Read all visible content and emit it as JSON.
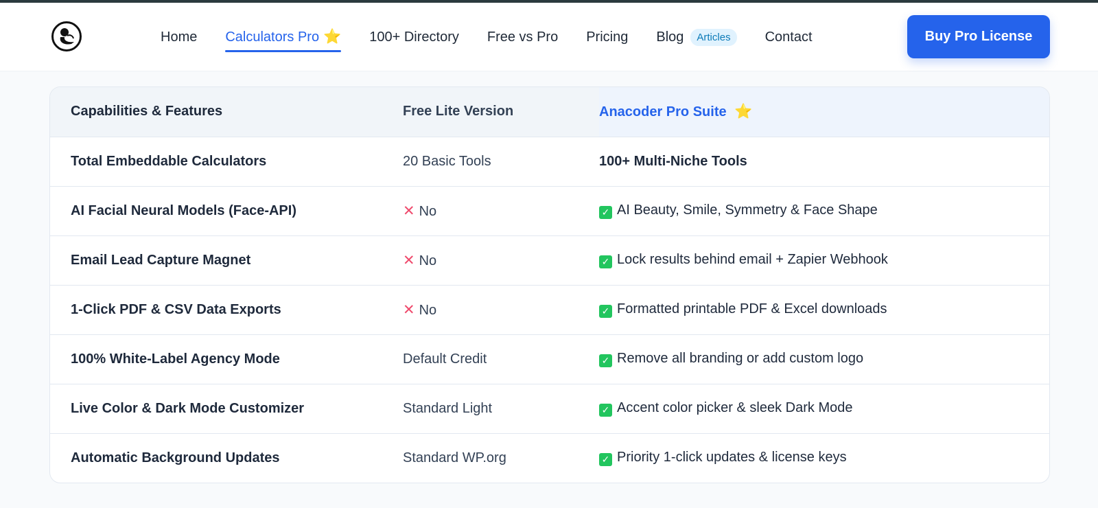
{
  "nav": {
    "items": [
      {
        "label": "Home"
      },
      {
        "label": "Calculators Pro",
        "active": true,
        "star": "⭐"
      },
      {
        "label": "100+ Directory"
      },
      {
        "label": "Free vs Pro"
      },
      {
        "label": "Pricing"
      },
      {
        "label": "Blog",
        "badge": "Articles"
      },
      {
        "label": "Contact"
      }
    ],
    "cta": "Buy Pro License"
  },
  "table": {
    "headers": {
      "feature": "Capabilities & Features",
      "free": "Free Lite Version",
      "pro": "Anacoder Pro Suite",
      "pro_star": "⭐"
    },
    "rows": [
      {
        "feature": "Total Embeddable Calculators",
        "free": "20 Basic Tools",
        "free_icon": "",
        "pro": "100+ Multi-Niche Tools",
        "pro_icon": ""
      },
      {
        "feature": "AI Facial Neural Models (Face-API)",
        "free": "No",
        "free_icon": "✕",
        "pro": "AI Beauty, Smile, Symmetry & Face Shape",
        "pro_icon": "✓"
      },
      {
        "feature": "Email Lead Capture Magnet",
        "free": "No",
        "free_icon": "✕",
        "pro": "Lock results behind email + Zapier Webhook",
        "pro_icon": "✓"
      },
      {
        "feature": "1-Click PDF & CSV Data Exports",
        "free": "No",
        "free_icon": "✕",
        "pro": "Formatted printable PDF & Excel downloads",
        "pro_icon": "✓"
      },
      {
        "feature": "100% White-Label Agency Mode",
        "free": "Default Credit",
        "free_icon": "",
        "pro": "Remove all branding or add custom logo",
        "pro_icon": "✓"
      },
      {
        "feature": "Live Color & Dark Mode Customizer",
        "free": "Standard Light",
        "free_icon": "",
        "pro": "Accent color picker & sleek Dark Mode",
        "pro_icon": "✓"
      },
      {
        "feature": "Automatic Background Updates",
        "free": "Standard WP.org",
        "free_icon": "",
        "pro": "Priority 1-click updates & license keys",
        "pro_icon": "✓"
      }
    ]
  },
  "colors": {
    "accent": "#2563eb",
    "check": "#22c55e",
    "cross": "#ef4a6c"
  }
}
